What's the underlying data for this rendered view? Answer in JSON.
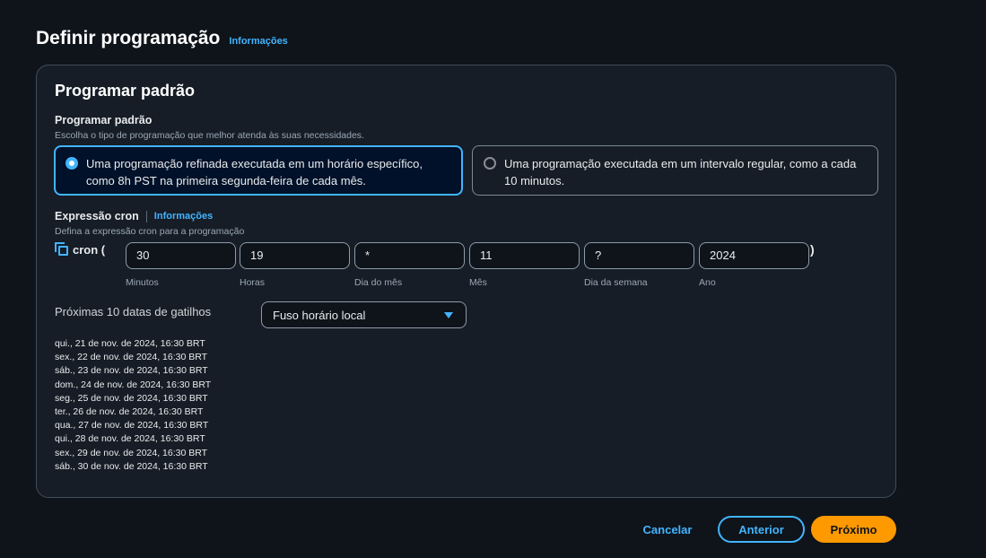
{
  "page": {
    "title": "Definir programação",
    "info_link": "Informações"
  },
  "panel": {
    "title": "Programar padrão",
    "pattern_label": "Programar padrão",
    "pattern_desc": "Escolha o tipo de programação que melhor atenda às suas necessidades.",
    "options": [
      {
        "label": "Uma programação refinada executada em um horário específico, como 8h PST na primeira segunda-feira de cada mês.",
        "selected": true
      },
      {
        "label": "Uma programação executada em um intervalo regular, como a cada 10 minutos.",
        "selected": false
      }
    ],
    "cron_label": "Expressão cron",
    "cron_info": "Informações",
    "cron_desc": "Defina a expressão cron para a programação",
    "cron_prefix": "cron (",
    "cron_suffix": ")",
    "cron_fields": [
      {
        "value": "30",
        "label": "Minutos"
      },
      {
        "value": "19",
        "label": "Horas"
      },
      {
        "value": "*",
        "label": "Dia do mês"
      },
      {
        "value": "11",
        "label": "Mês"
      },
      {
        "value": "?",
        "label": "Dia da semana"
      },
      {
        "value": "2024",
        "label": "Ano"
      }
    ],
    "triggers_label": "Próximas 10 datas de gatilhos",
    "timezone_selected": "Fuso horário local",
    "trigger_dates": [
      "qui., 21 de nov. de 2024, 16:30 BRT",
      "sex., 22 de nov. de 2024, 16:30 BRT",
      "sáb., 23 de nov. de 2024, 16:30 BRT",
      "dom., 24 de nov. de 2024, 16:30 BRT",
      "seg., 25 de nov. de 2024, 16:30 BRT",
      "ter., 26 de nov. de 2024, 16:30 BRT",
      "qua., 27 de nov. de 2024, 16:30 BRT",
      "qui., 28 de nov. de 2024, 16:30 BRT",
      "sex., 29 de nov. de 2024, 16:30 BRT",
      "sáb., 30 de nov. de 2024, 16:30 BRT"
    ]
  },
  "footer": {
    "cancel": "Cancelar",
    "previous": "Anterior",
    "next": "Próximo"
  },
  "colors": {
    "accent": "#42b4ff",
    "primary_button": "#ff9900",
    "background": "#0f141a"
  },
  "icons": {
    "copy": "copy-icon",
    "dropdown": "caret-down-icon"
  }
}
